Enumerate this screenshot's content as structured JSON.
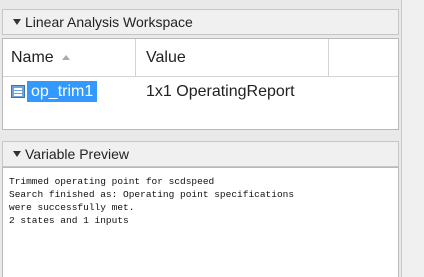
{
  "workspace": {
    "title": "Linear Analysis Workspace",
    "columns": {
      "name": "Name",
      "value": "Value"
    },
    "rows": [
      {
        "name": "op_trim1",
        "value": "1x1 OperatingReport"
      }
    ]
  },
  "preview": {
    "title": "Variable Preview",
    "lines": [
      "Trimmed operating point for scdspeed",
      "Search finished as: Operating point specifications",
      "were successfully met.",
      "2 states and 1 inputs"
    ]
  },
  "colors": {
    "selection": "#3399ff",
    "header_bg": "#f0f0f0"
  }
}
